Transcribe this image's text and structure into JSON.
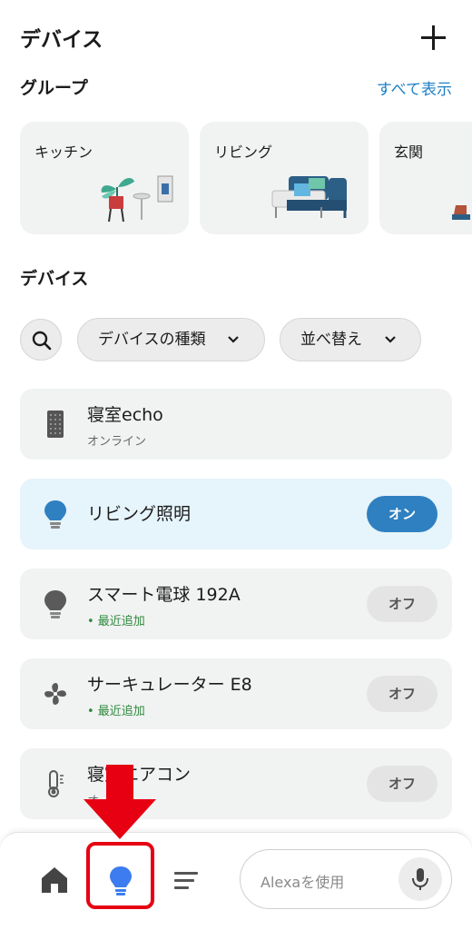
{
  "header": {
    "title": "デバイス",
    "add_icon": "plus-icon"
  },
  "groups_section": {
    "title": "グループ",
    "show_all": "すべて表示",
    "cards": [
      {
        "name": "キッチン"
      },
      {
        "name": "リビング"
      },
      {
        "name": "玄関"
      }
    ]
  },
  "devices_section": {
    "title": "デバイス",
    "filters": {
      "search_icon": "search-icon",
      "type_chip": "デバイスの種類",
      "sort_chip": "並べ替え"
    },
    "items": [
      {
        "name": "寝室echo",
        "status": "オンライン",
        "icon": "echo-speaker-icon"
      },
      {
        "name": "リビング照明",
        "status": "",
        "icon": "bulb-icon",
        "toggle": "オン",
        "state": "on"
      },
      {
        "name": "スマート電球 192A",
        "status": "• 最近追加",
        "icon": "bulb-icon",
        "toggle": "オフ",
        "state": "off"
      },
      {
        "name": "サーキュレーター E8",
        "status": "• 最近追加",
        "icon": "fan-icon",
        "toggle": "オフ",
        "state": "off"
      },
      {
        "name": "寝室エアコン",
        "status": "オ",
        "icon": "thermometer-icon",
        "toggle": "オフ",
        "state": "off"
      }
    ]
  },
  "bottom_nav": {
    "home_icon": "home-icon",
    "devices_icon": "bulb-icon",
    "more_icon": "menu-icon",
    "alexa_placeholder": "Alexaを使用",
    "mic_icon": "mic-icon"
  },
  "colors": {
    "accent": "#2f80c1",
    "on_card_bg": "#e6f4fb",
    "link": "#1f7fc4",
    "new_badge": "#2e8a3e",
    "annotation_red": "#e60012",
    "active_nav": "#3d7cf0"
  }
}
